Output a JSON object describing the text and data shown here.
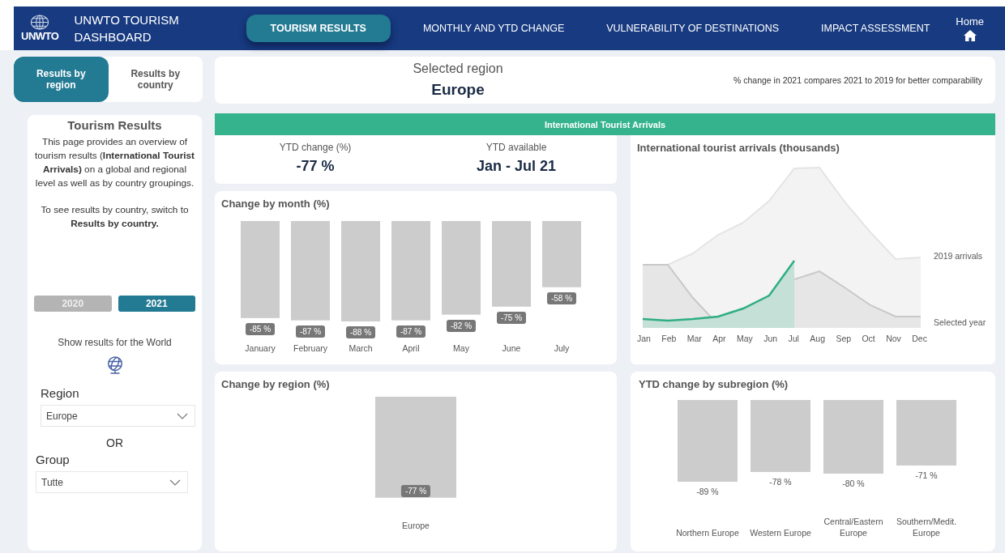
{
  "header": {
    "logo_text": "UNWTO",
    "title": "UNWTO TOURISM DASHBOARD",
    "home": "Home",
    "tabs": [
      {
        "label": "TOURISM RESULTS",
        "selected": true
      },
      {
        "label": "MONTHLY AND YTD CHANGE",
        "selected": false
      },
      {
        "label": "VULNERABILITY OF DESTINATIONS",
        "selected": false
      },
      {
        "label": "IMPACT ASSESSMENT",
        "selected": false
      }
    ]
  },
  "view_toggle": [
    {
      "label": "Results by region",
      "selected": true
    },
    {
      "label": "Results by country",
      "selected": false
    }
  ],
  "intro": {
    "title": "Tourism Results",
    "paragraphs": [
      "This page provides an overview of tourism results (**International Tourist Arrivals)** on a global and regional level as well as by country groupings.",
      "To see  results by country, switch to **Results by country.**"
    ]
  },
  "years": [
    {
      "label": "2020",
      "selected": false
    },
    {
      "label": "2021",
      "selected": true
    }
  ],
  "world_link": "Show results for the World",
  "region_filter": {
    "label": "Region",
    "value": "Europe"
  },
  "or_text": "OR",
  "group_filter": {
    "label": "Group",
    "value": "Tutte"
  },
  "selected_region": {
    "label": "Selected region",
    "value": "Europe",
    "note": "% change in 2021 compares 2021 to 2019 for better comparability"
  },
  "section_title": "International Tourist Arrivals",
  "kpis": [
    {
      "label": "YTD change (%)",
      "value": "-77 %"
    },
    {
      "label": "YTD available",
      "value": "Jan - Jul 21"
    }
  ],
  "month_chart": {
    "title": "Change by month (%)",
    "chart_data": {
      "type": "bar",
      "categories": [
        "January",
        "February",
        "March",
        "April",
        "May",
        "June",
        "July"
      ],
      "values": [
        -85,
        -87,
        -88,
        -87,
        -82,
        -75,
        -58
      ],
      "value_labels": [
        "-85 %",
        "-87 %",
        "-88 %",
        "-87 %",
        "-82 %",
        "-75 %",
        "-58 %"
      ],
      "data_labels": true
    }
  },
  "arrivals_chart": {
    "title": "International tourist arrivals (thousands)",
    "months": [
      "Jan",
      "Feb",
      "Mar",
      "Apr",
      "May",
      "Jun",
      "Jul",
      "Aug",
      "Sep",
      "Oct",
      "Nov",
      "Dec"
    ],
    "legend": [
      "2019 arrivals",
      "Selected year"
    ]
  },
  "region_chart": {
    "title": "Change by region (%)",
    "chart_data": {
      "type": "bar",
      "categories": [
        "Europe"
      ],
      "values": [
        -77
      ],
      "value_labels": [
        "-77 %"
      ],
      "data_labels": true
    }
  },
  "subregion_chart": {
    "title": "YTD change by subregion (%)",
    "chart_data": {
      "type": "bar",
      "categories": [
        "Northern Europe",
        "Western Europe",
        "Central/Eastern Europe",
        "Southern/Medit. Europe"
      ],
      "values": [
        -89,
        -78,
        -80,
        -71
      ],
      "value_labels": [
        "-89 %",
        "-78 %",
        "-80 %",
        "-71 %"
      ],
      "data_labels": true
    }
  }
}
